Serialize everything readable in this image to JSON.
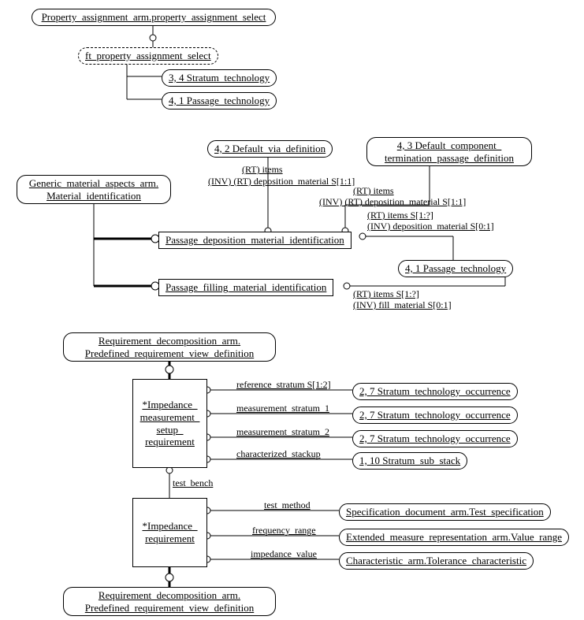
{
  "top": {
    "root": "Property_assignment_arm.property_assignment_select",
    "child": "ft_property_assignment_select",
    "c1": "3, 4 Stratum_technology",
    "c2": "4, 1 Passage_technology"
  },
  "mid": {
    "gma": "Generic_material_aspects_arm. Material_identification",
    "dvd": "4, 2 Default_via_definition",
    "dcp1": "4, 3 Default_component_",
    "dcp2": "termination_passage_definition",
    "pdmi": "Passage_deposition_material_identification",
    "pfmi": "Passage_filling_material_identification",
    "pt": "4, 1 Passage_technology",
    "l1a": "(RT) items",
    "l1b": "(INV) (RT) deposition_material S[1:1]",
    "l2a": "(RT) items",
    "l2b": "(INV) (RT) deposition_material S[1:1]",
    "l3a": "(RT) items S[1:?]",
    "l3b": "(INV) deposition_material S[0:1]",
    "l4a": "(RT) items S[1:?]",
    "l4b": "(INV) fill_material S[0:1]"
  },
  "bot": {
    "rdv1": "Requirement_decomposition_arm.",
    "rdv2": "Predefined_requirement_view_definition",
    "imsr1": "*Impedance_",
    "imsr2": "measurement_",
    "imsr3": "setup_",
    "imsr4": "requirement",
    "ir1": "*Impedance_",
    "ir2": "requirement",
    "a1": "reference_stratum S[1:2]",
    "a2": "measurement_stratum_1",
    "a3": "measurement_stratum_2",
    "a4": "characterized_stackup",
    "t1": "2, 7 Stratum_technology_occurrence",
    "t2": "2, 7 Stratum_technology_occurrence",
    "t3": "2, 7 Stratum_technology_occurrence",
    "t4": "1, 10 Stratum_sub_stack",
    "tb": "test_bench",
    "b1": "test_method",
    "b2": "frequency_range",
    "b3": "impedance_value",
    "bt1": "Specification_document_arm.Test_specification",
    "bt2": "Extended_measure_representation_arm.Value_range",
    "bt3": "Characteristic_arm.Tolerance_characteristic"
  }
}
